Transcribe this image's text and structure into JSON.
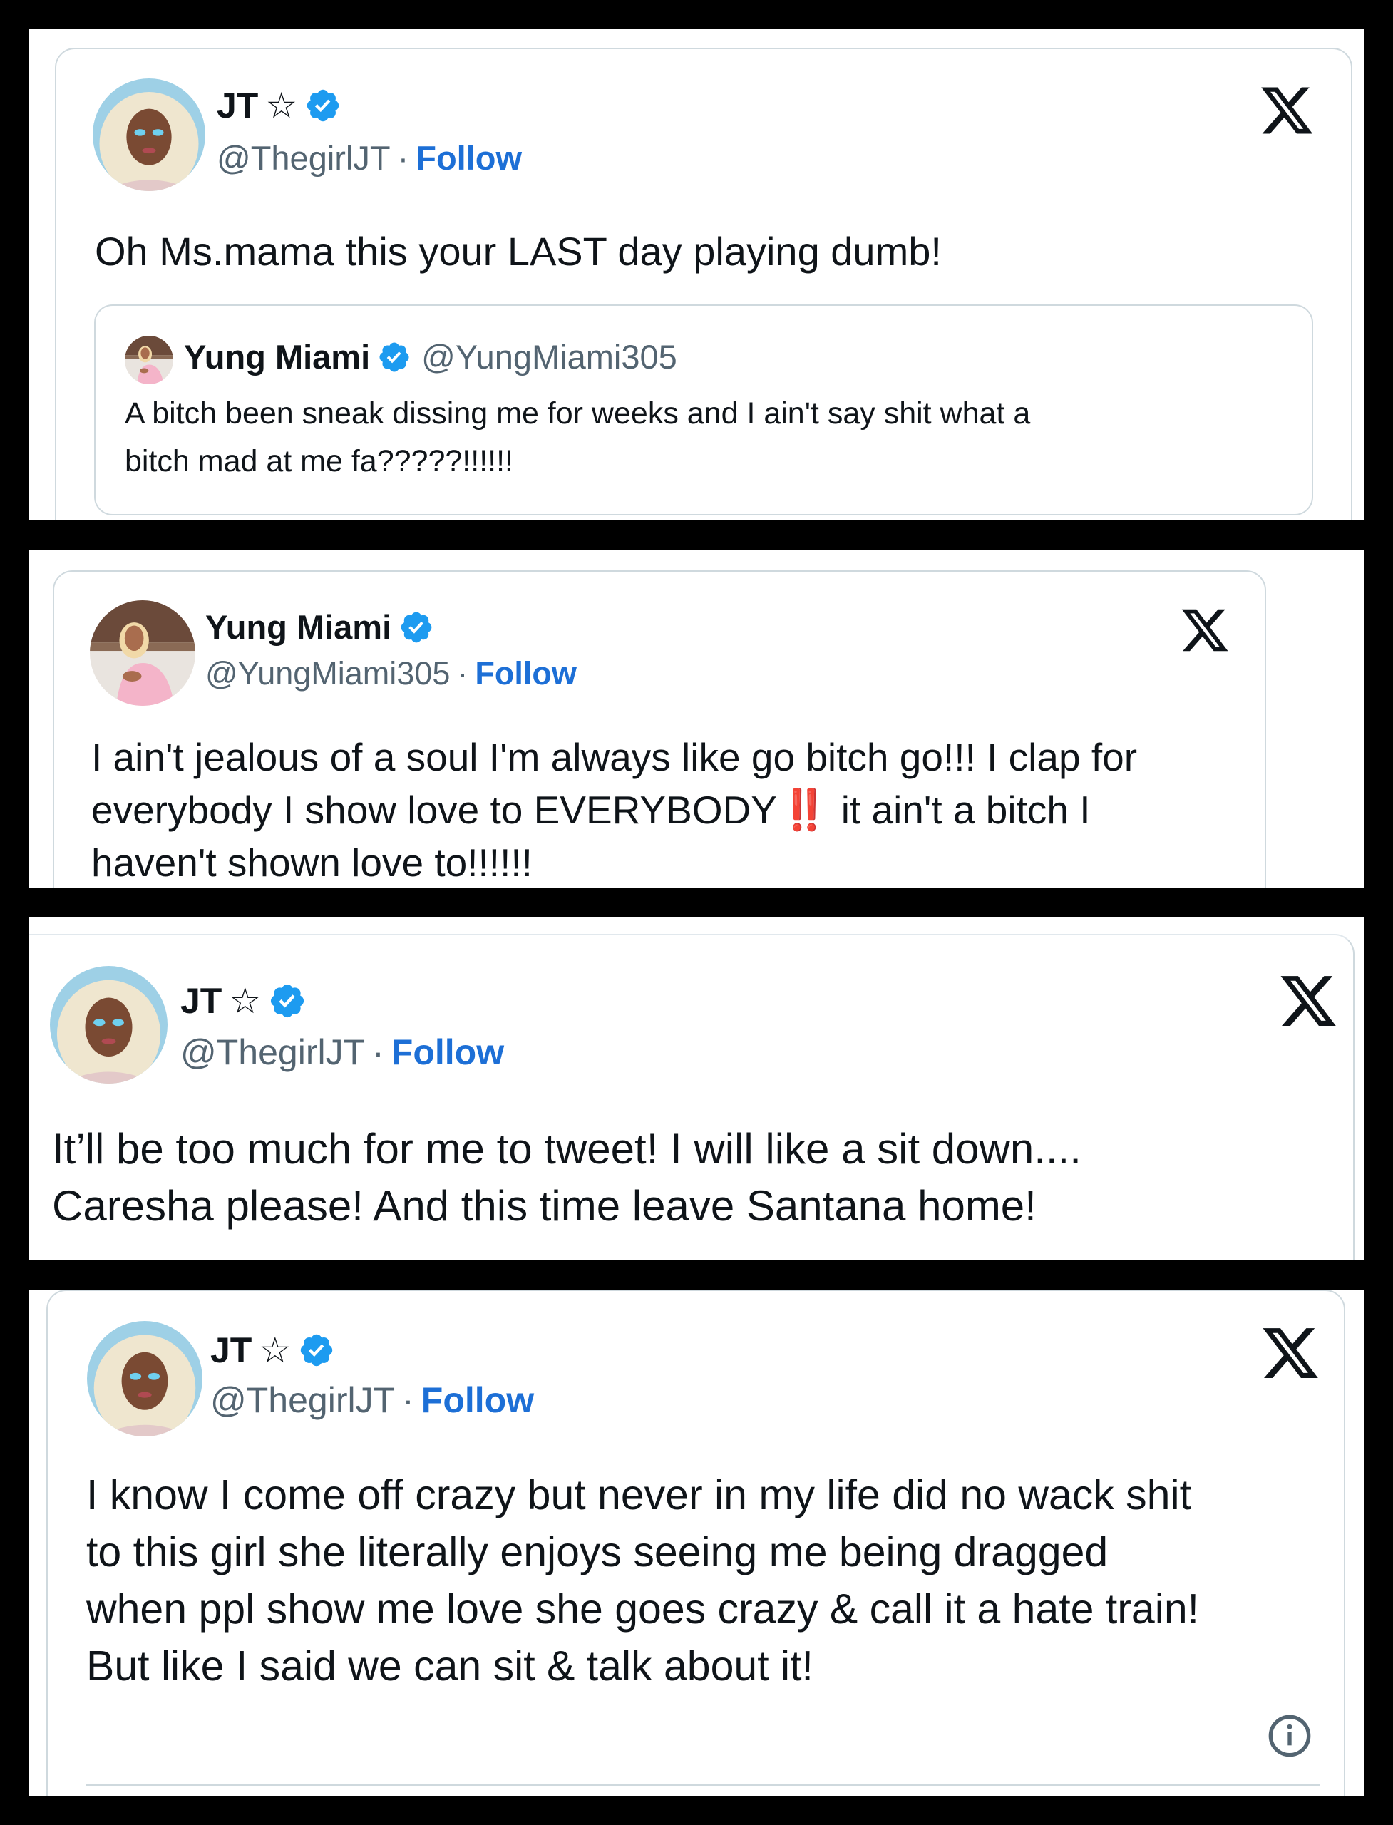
{
  "tweets": [
    {
      "author_name": "JT",
      "author_star": "☆",
      "handle": "@ThegirlJT",
      "separator": "·",
      "follow_label": "Follow",
      "text": "Oh Ms.mama this your LAST day playing dumb!",
      "quote": {
        "author_name": "Yung Miami",
        "handle": "@YungMiami305",
        "text": "A bitch been sneak dissing me for weeks and I ain't say shit what a\nbitch mad at me fa?????!!!!!!"
      }
    },
    {
      "author_name": "Yung Miami",
      "handle": "@YungMiami305",
      "separator": "·",
      "follow_label": "Follow",
      "text_part1": "I ain't jealous of a soul I'm always like go bitch go!!! I clap for\neverybody I show love to EVERYBODY",
      "emoji": "‼️",
      "text_part2": "it ain't a bitch I\nhaven't shown love to!!!!!!"
    },
    {
      "author_name": "JT",
      "author_star": "☆",
      "handle": "@ThegirlJT",
      "separator": "·",
      "follow_label": "Follow",
      "text": "It’ll be too much for me to tweet! I will like a sit down....\nCaresha please! And this time leave Santana home!"
    },
    {
      "author_name": "JT",
      "author_star": "☆",
      "handle": "@ThegirlJT",
      "separator": "·",
      "follow_label": "Follow",
      "text": "I know I come off crazy but never in my life did no wack shit\nto this girl she literally enjoys seeing me being dragged\nwhen ppl show me love she goes crazy & call it a hate train!\nBut like I said we can sit & talk about it!"
    }
  ],
  "icons": {
    "verified": "verified-badge-icon",
    "x_logo": "x-logo-icon",
    "info": "info-icon"
  },
  "colors": {
    "follow": "#1d6fd6",
    "verified": "#1d9bf0",
    "border": "#cfd9de",
    "handle": "#536471"
  }
}
